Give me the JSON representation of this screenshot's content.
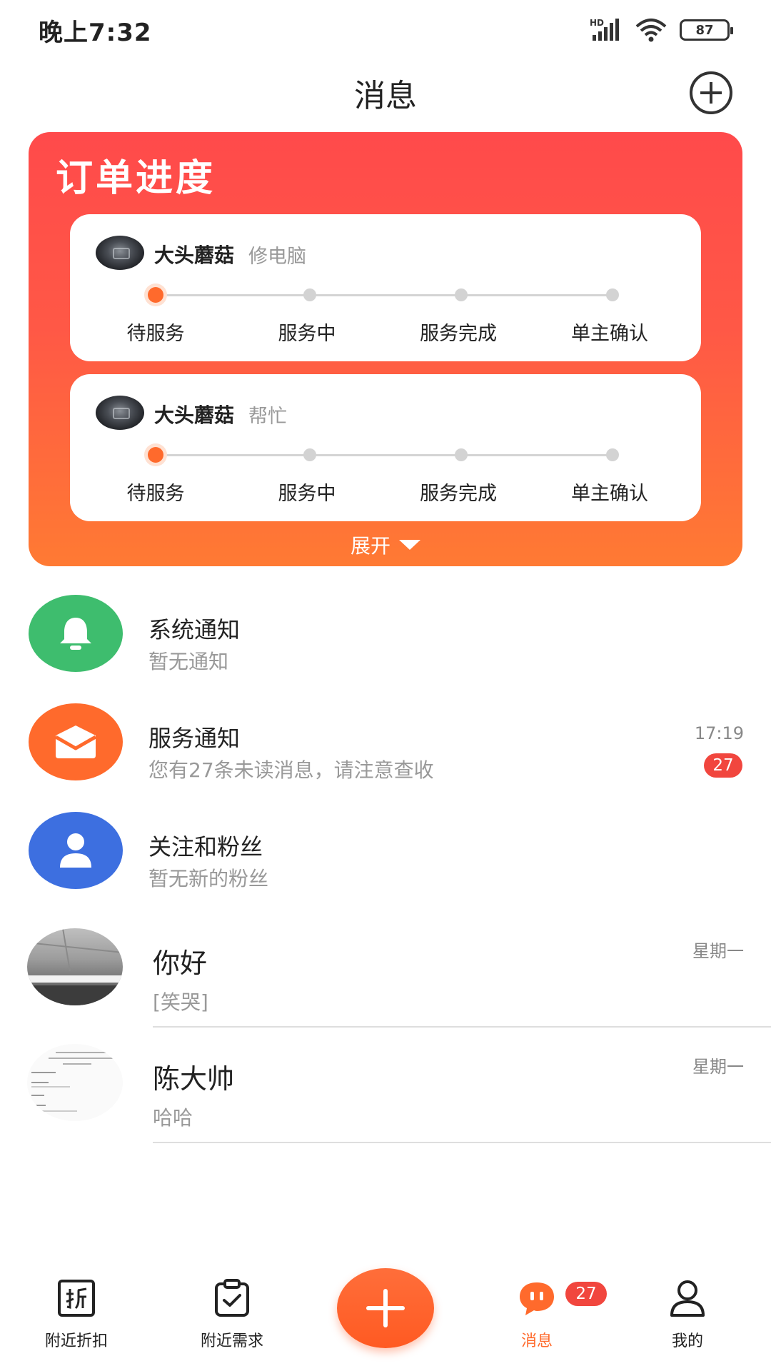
{
  "status_bar": {
    "time": "晚上7:32",
    "network": "HD",
    "battery": "87",
    "icons": [
      "signal-icon",
      "wifi-icon",
      "battery-icon"
    ]
  },
  "header": {
    "title": "消息",
    "add_icon": "plus-circle-icon"
  },
  "order_progress": {
    "title": "订单进度",
    "expand_label": "展开",
    "steps": [
      "待服务",
      "服务中",
      "服务完成",
      "单主确认"
    ],
    "orders": [
      {
        "name": "大头蘑菇",
        "service": "修电脑",
        "current_step": 0
      },
      {
        "name": "大头蘑菇",
        "service": "帮忙",
        "current_step": 0
      }
    ]
  },
  "notifications": [
    {
      "title": "系统通知",
      "subtitle": "暂无通知",
      "icon": "bell-icon",
      "color": "#3ebd6e"
    },
    {
      "title": "服务通知",
      "subtitle": "您有27条未读消息，请注意查收",
      "time": "17:19",
      "badge": "27",
      "icon": "envelope-icon",
      "color": "#ff6a2c"
    },
    {
      "title": "关注和粉丝",
      "subtitle": "暂无新的粉丝",
      "icon": "person-icon",
      "color": "#3d6fe0"
    }
  ],
  "chats": [
    {
      "name": "你好",
      "last_message": "[笑哭]",
      "time": "星期一"
    },
    {
      "name": "陈大帅",
      "last_message": "哈哈",
      "time": "星期一"
    }
  ],
  "bottom_nav": {
    "items": [
      {
        "label": "附近折扣",
        "icon": "discount-icon"
      },
      {
        "label": "附近需求",
        "icon": "clipboard-check-icon"
      },
      {
        "label": "消息",
        "icon": "chat-bubble-icon",
        "badge": "27"
      },
      {
        "label": "我的",
        "icon": "profile-icon"
      }
    ],
    "center_icon": "plus-icon"
  },
  "colors": {
    "accent": "#ff6a2c",
    "badge": "#f1463e",
    "card_gradient_top": "#ff4a4b",
    "card_gradient_bottom": "#ff7a33"
  }
}
